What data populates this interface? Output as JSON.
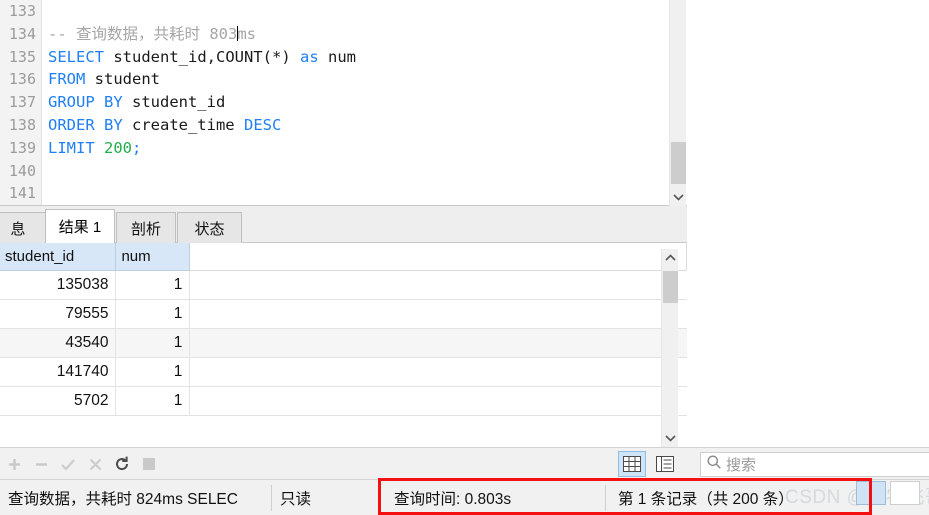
{
  "editor": {
    "line_numbers": [
      "133",
      "134",
      "135",
      "136",
      "137",
      "138",
      "139",
      "140",
      "141"
    ],
    "lines": [
      {
        "n": "133",
        "segments": []
      },
      {
        "n": "134",
        "segments": [
          {
            "t": "-- 查询数据，共耗时 803",
            "c": "cmt"
          },
          {
            "t": "CARET",
            "c": "caret"
          },
          {
            "t": "ms",
            "c": "cmt"
          }
        ]
      },
      {
        "n": "135",
        "segments": [
          {
            "t": "SELECT",
            "c": "kw"
          },
          {
            "t": " student_id,",
            "c": "id"
          },
          {
            "t": "COUNT",
            "c": "id"
          },
          {
            "t": "(*) ",
            "c": "id"
          },
          {
            "t": "as",
            "c": "kw"
          },
          {
            "t": " num",
            "c": "id"
          }
        ]
      },
      {
        "n": "136",
        "segments": [
          {
            "t": "FROM",
            "c": "kw"
          },
          {
            "t": " student",
            "c": "id"
          }
        ]
      },
      {
        "n": "137",
        "segments": [
          {
            "t": "GROUP BY",
            "c": "kw"
          },
          {
            "t": " student_id",
            "c": "id"
          }
        ]
      },
      {
        "n": "138",
        "segments": [
          {
            "t": "ORDER BY",
            "c": "kw"
          },
          {
            "t": " create_time ",
            "c": "id"
          },
          {
            "t": "DESC",
            "c": "kw"
          }
        ]
      },
      {
        "n": "139",
        "segments": [
          {
            "t": "LIMIT",
            "c": "kw"
          },
          {
            "t": " ",
            "c": "id"
          },
          {
            "t": "200",
            "c": "num"
          },
          {
            "t": ";",
            "c": "kw"
          }
        ]
      },
      {
        "n": "140",
        "segments": []
      },
      {
        "n": "141",
        "segments": []
      }
    ]
  },
  "tabs": [
    {
      "label": "息",
      "active": false
    },
    {
      "label": "结果 1",
      "active": true
    },
    {
      "label": "剖析",
      "active": false
    },
    {
      "label": "状态",
      "active": false
    }
  ],
  "grid": {
    "columns": [
      "student_id",
      "num"
    ],
    "rows": [
      {
        "student_id": "135038",
        "num": "1",
        "selected": false
      },
      {
        "student_id": "79555",
        "num": "1",
        "selected": false
      },
      {
        "student_id": "43540",
        "num": "1",
        "selected": true
      },
      {
        "student_id": "141740",
        "num": "1",
        "selected": false
      },
      {
        "student_id": "5702",
        "num": "1",
        "selected": false
      }
    ]
  },
  "toolbar": {
    "icons": [
      "plus-icon",
      "minus-icon",
      "check-icon",
      "close-icon",
      "refresh-icon",
      "stop-icon"
    ],
    "view_grid": "grid-view-icon",
    "view_form": "form-view-icon",
    "search_placeholder": "搜索",
    "search_value": ""
  },
  "status": {
    "message": "查询数据，共耗时 824ms SELEC",
    "readonly": "只读",
    "query_time": "查询时间: 0.803s",
    "record_info": "第 1 条记录（共 200 条）",
    "highlight_color": "#f41010"
  },
  "watermark": {
    "text": "CSDN @码农飞哥"
  }
}
